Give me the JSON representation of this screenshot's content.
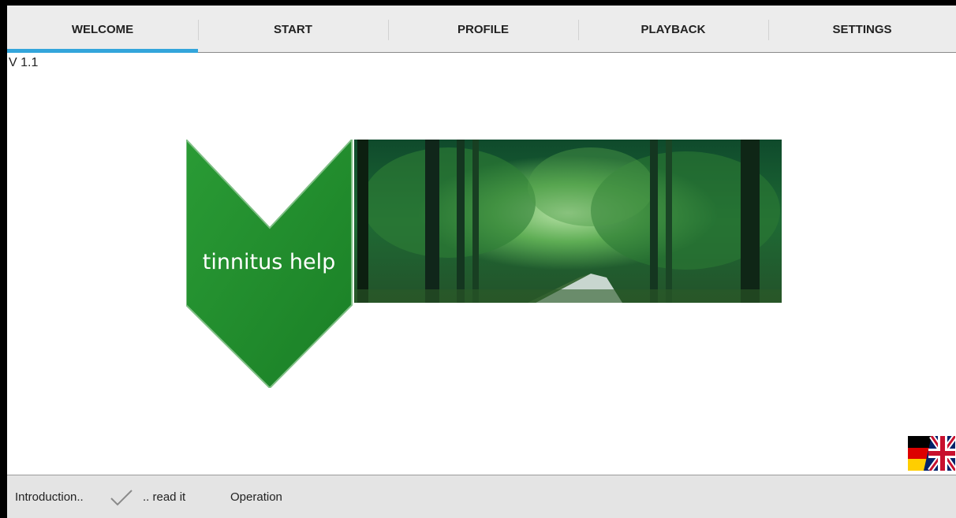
{
  "tabs": [
    {
      "label": "WELCOME",
      "active": true
    },
    {
      "label": "START"
    },
    {
      "label": "PROFILE"
    },
    {
      "label": "PLAYBACK"
    },
    {
      "label": "SETTINGS"
    }
  ],
  "version": "V 1.1",
  "logo": {
    "text": "tinnitus help",
    "color": "#1f8f2c"
  },
  "language_flags": [
    "german-flag-icon",
    "uk-flag-icon"
  ],
  "footer": {
    "introduction": "Introduction..",
    "checkmark_icon": "checkmark-icon",
    "read_it": ".. read it",
    "operation": "Operation"
  },
  "colors": {
    "tab_indicator": "#33a5db",
    "tab_bg": "#ececec",
    "footer_bg": "#e4e4e4"
  }
}
